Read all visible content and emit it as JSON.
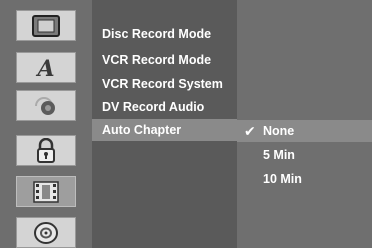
{
  "sidebar": {
    "icons": [
      {
        "name": "display-icon"
      },
      {
        "name": "language-icon"
      },
      {
        "name": "audio-icon"
      },
      {
        "name": "lock-icon"
      },
      {
        "name": "record-icon"
      },
      {
        "name": "disc-icon"
      }
    ],
    "selected": "record-icon"
  },
  "menu": {
    "items": [
      {
        "label": "Disc Record Mode"
      },
      {
        "label": "VCR Record Mode"
      },
      {
        "label": "VCR Record System"
      },
      {
        "label": "DV Record Audio"
      },
      {
        "label": "Auto Chapter"
      }
    ],
    "selected": "Auto Chapter"
  },
  "options": {
    "items": [
      {
        "label": "None",
        "checked": true
      },
      {
        "label": "5 Min",
        "checked": false
      },
      {
        "label": "10 Min",
        "checked": false
      }
    ],
    "check_glyph": "✔"
  },
  "colors": {
    "icon_column": "#6e6e6e",
    "menu_column": "#5a5a5a",
    "option_column": "#6f6f6f",
    "highlight": "#8a8a8a"
  }
}
